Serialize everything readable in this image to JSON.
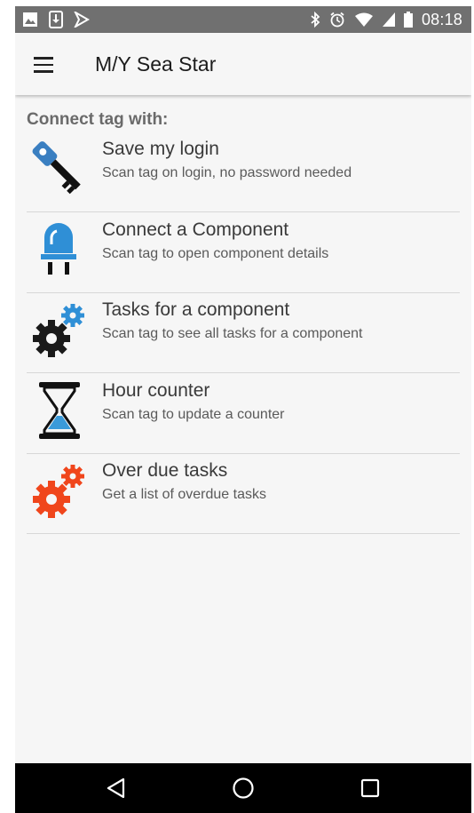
{
  "status_bar": {
    "time": "08:18",
    "left_icons": [
      "image-icon",
      "download-icon",
      "flag-icon"
    ],
    "right_icons": [
      "bluetooth-icon",
      "alarm-icon",
      "wifi-icon",
      "signal-icon",
      "battery-icon"
    ]
  },
  "app_bar": {
    "title": "M/Y Sea Star",
    "menu_icon": "hamburger-menu-icon"
  },
  "section": {
    "header": "Connect tag with:"
  },
  "items": [
    {
      "title": "Save my login",
      "subtitle": "Scan tag on login, no password needed",
      "icon": "key-icon",
      "color": "#3a7fc1"
    },
    {
      "title": "Connect a Component",
      "subtitle": "Scan tag to open component details",
      "icon": "led-icon",
      "color": "#2f8fd6"
    },
    {
      "title": "Tasks for a component",
      "subtitle": "Scan tag to see all tasks for a component",
      "icon": "gears-icon",
      "color": "#2f8fd6"
    },
    {
      "title": "Hour counter",
      "subtitle": "Scan tag to update a counter",
      "icon": "hourglass-icon",
      "color": "#3a9ad9"
    },
    {
      "title": "Over due tasks",
      "subtitle": "Get a list of overdue tasks",
      "icon": "overdue-gears-icon",
      "color": "#f0461c"
    }
  ],
  "nav_bar": {
    "buttons": [
      "back-icon",
      "home-icon",
      "recents-icon"
    ]
  }
}
